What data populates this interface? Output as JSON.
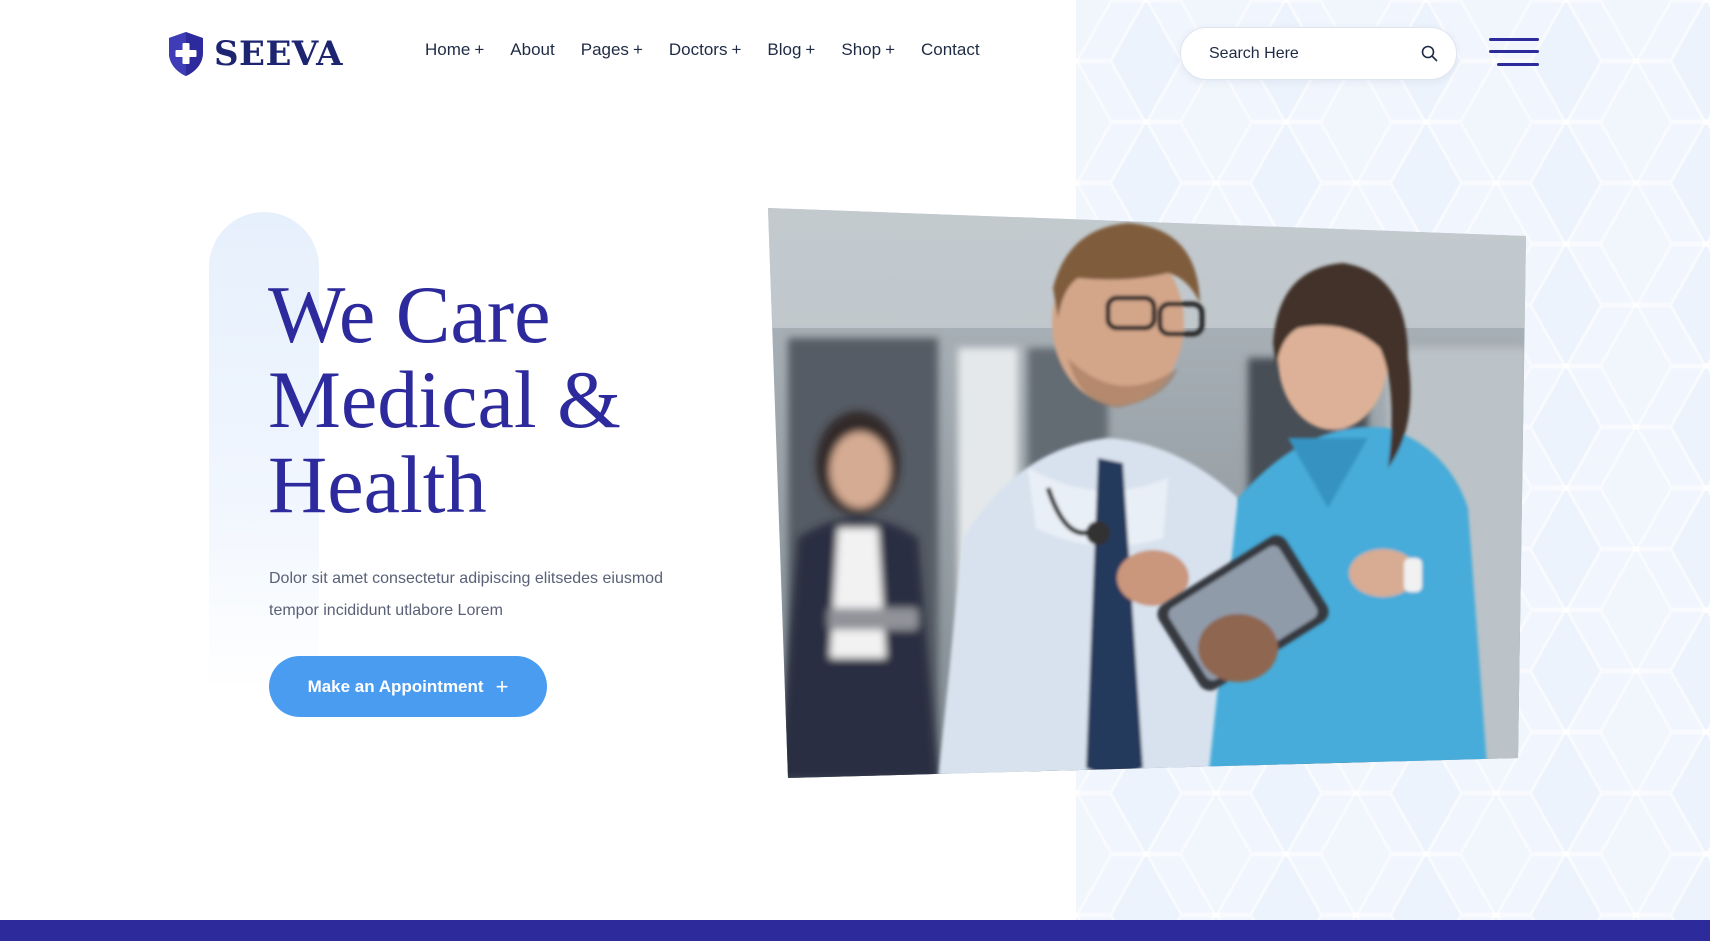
{
  "brand": {
    "name": "SEEVA",
    "primary_color": "#2c2a9c",
    "accent_color": "#4a9cf1",
    "logo_icon": "shield-cross-icon"
  },
  "nav": {
    "items": [
      {
        "label": "Home",
        "has_submenu": true
      },
      {
        "label": "About",
        "has_submenu": false
      },
      {
        "label": "Pages",
        "has_submenu": true
      },
      {
        "label": "Doctors",
        "has_submenu": true
      },
      {
        "label": "Blog",
        "has_submenu": true
      },
      {
        "label": "Shop",
        "has_submenu": true
      },
      {
        "label": "Contact",
        "has_submenu": false
      }
    ],
    "submenu_indicator": "+"
  },
  "search": {
    "placeholder": "Search Here",
    "value": "",
    "icon": "search-icon"
  },
  "menu_toggle": {
    "icon": "hamburger-menu-icon"
  },
  "hero": {
    "title_lines": [
      "We Care",
      "Medical &",
      "Health"
    ],
    "description": "Dolor sit amet consectetur adipiscing elitsedes eiusmod tempor incididunt utlabore Lorem",
    "cta_label": "Make an Appointment",
    "cta_icon": "plus-icon",
    "cta_symbol": "+",
    "image_subject": "doctor-and-nurse-with-tablet-photo"
  }
}
